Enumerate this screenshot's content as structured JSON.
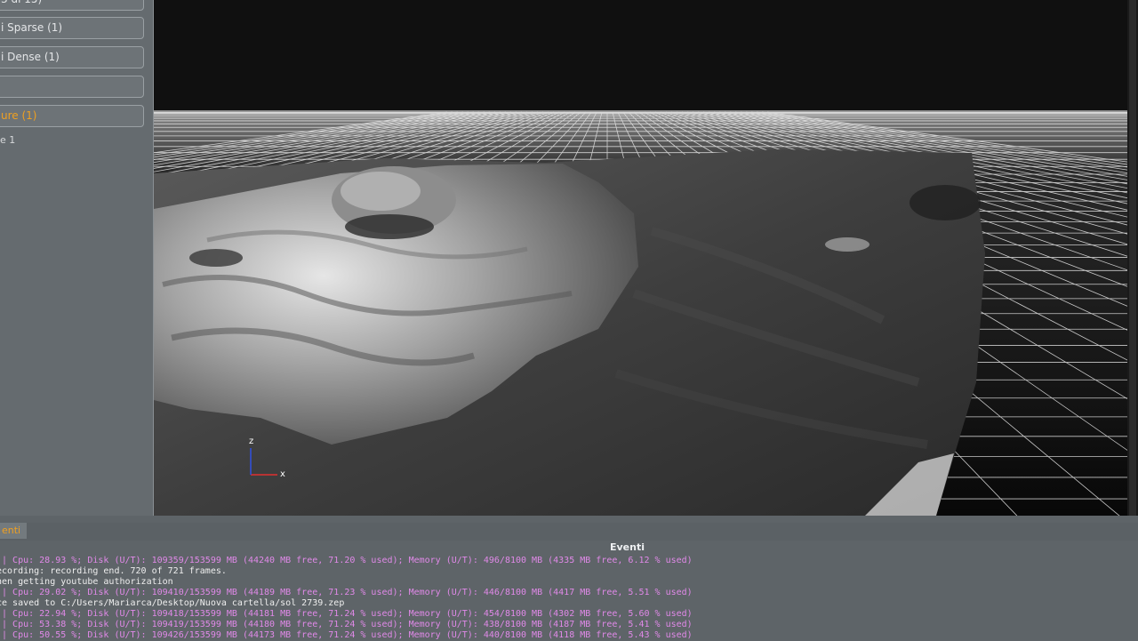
{
  "left_panel": {
    "buttons": [
      {
        "label": "3 di 15)"
      },
      {
        "label": "i Sparse (1)"
      },
      {
        "label": "i Dense (1)"
      },
      {
        "label": ""
      },
      {
        "label": "ure (1)"
      }
    ],
    "sub_item": "e 1"
  },
  "viewport": {
    "axis_z": "z",
    "axis_x": "x",
    "colors": {
      "grid": "#ffffff",
      "terrain_dark": "#3a3a3a",
      "terrain_light": "#c8c8c8",
      "axis_x": "#e03030",
      "axis_z": "#3050e0"
    }
  },
  "events": {
    "tab_label": "enti",
    "title": "Eventi",
    "lines": [
      {
        "text": " | Cpu: 28.93 %; Disk (U/T): 109359/153599 MB (44240 MB free, 71.20 % used); Memory (U/T): 496/8100 MB (4335 MB free, 6.12 % used)",
        "color": "pink"
      },
      {
        "text": "ecording: recording end. 720 of 721 frames.",
        "color": "white"
      },
      {
        "text": "hen getting youtube authorization",
        "color": "white"
      },
      {
        "text": " | Cpu: 29.02 %; Disk (U/T): 109410/153599 MB (44189 MB free, 71.23 % used); Memory (U/T): 446/8100 MB (4417 MB free, 5.51 % used)",
        "color": "pink"
      },
      {
        "text": "ce saved to C:/Users/Mariarca/Desktop/Nuova cartella/sol 2739.zep",
        "color": "white"
      },
      {
        "text": " | Cpu: 22.94 %; Disk (U/T): 109418/153599 MB (44181 MB free, 71.24 % used); Memory (U/T): 454/8100 MB (4302 MB free, 5.60 % used)",
        "color": "pink"
      },
      {
        "text": " | Cpu: 53.38 %; Disk (U/T): 109419/153599 MB (44180 MB free, 71.24 % used); Memory (U/T): 438/8100 MB (4187 MB free, 5.41 % used)",
        "color": "pink"
      },
      {
        "text": " | Cpu: 50.55 %; Disk (U/T): 109426/153599 MB (44173 MB free, 71.24 % used); Memory (U/T): 440/8100 MB (4118 MB free, 5.43 % used)",
        "color": "pink"
      }
    ]
  }
}
